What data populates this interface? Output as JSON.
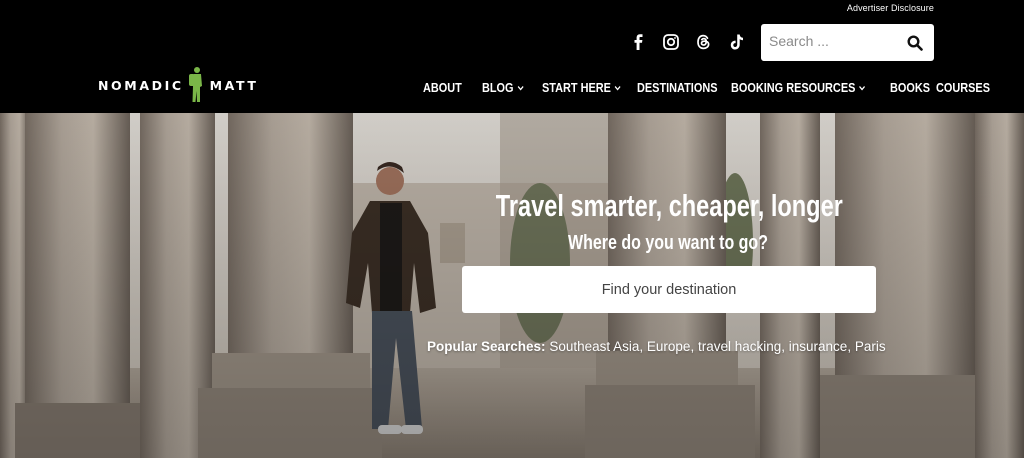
{
  "header": {
    "advertiser_disclosure": "Advertiser Disclosure",
    "socials": [
      {
        "name": "facebook-icon"
      },
      {
        "name": "instagram-icon"
      },
      {
        "name": "threads-icon"
      },
      {
        "name": "tiktok-icon"
      }
    ],
    "search": {
      "placeholder": "Search ..."
    },
    "logo": {
      "left": "NOMADIC",
      "right": "MATT",
      "figure_color": "#7ab648"
    },
    "nav": [
      {
        "label": "ABOUT",
        "has_dropdown": false
      },
      {
        "label": "BLOG",
        "has_dropdown": true
      },
      {
        "label": "START HERE",
        "has_dropdown": true
      },
      {
        "label": "DESTINATIONS",
        "has_dropdown": false
      },
      {
        "label": "BOOKING RESOURCES",
        "has_dropdown": true
      },
      {
        "label": "BOOKS",
        "has_dropdown": false
      },
      {
        "label": "COURSES",
        "has_dropdown": false
      }
    ]
  },
  "hero": {
    "title": "Travel smarter, cheaper, longer",
    "subtitle": "Where do you want to go?",
    "button_label": "Find your destination",
    "popular": {
      "label": "Popular Searches:",
      "links": [
        "Southeast Asia",
        "Europe",
        "travel hacking",
        "insurance",
        "Paris"
      ]
    }
  },
  "colors": {
    "header_bg": "#000000",
    "logo_green": "#7ab648",
    "button_bg": "#ffffff"
  }
}
